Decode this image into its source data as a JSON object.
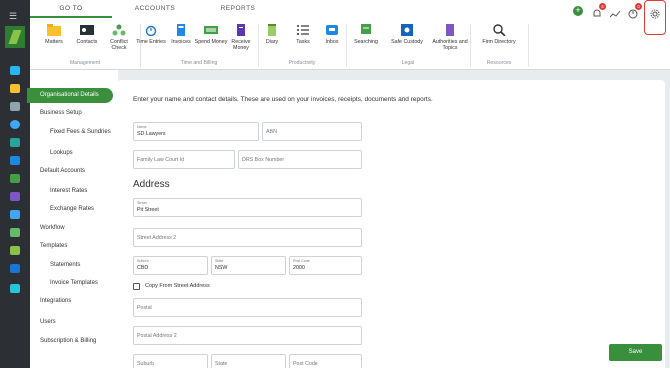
{
  "tabs": [
    "GO TO",
    "ACCOUNTS",
    "REPORTS"
  ],
  "badges": {
    "notifications": "4",
    "timer": "0"
  },
  "ribbon": {
    "items": [
      {
        "label": "Matters",
        "icon": "folder-icon"
      },
      {
        "label": "Contacts",
        "icon": "contact-card-icon"
      },
      {
        "label": "Conflict Check",
        "icon": "org-chart-icon"
      },
      {
        "label": "Time Entries",
        "icon": "stopwatch-icon"
      },
      {
        "label": "Invoices",
        "icon": "calculator-icon"
      },
      {
        "label": "Spend Money",
        "icon": "cash-out-icon"
      },
      {
        "label": "Receive Money",
        "icon": "receive-money-icon"
      },
      {
        "label": "Diary",
        "icon": "notepad-icon"
      },
      {
        "label": "Tasks",
        "icon": "task-list-icon"
      },
      {
        "label": "Inbox",
        "icon": "inbox-icon"
      },
      {
        "label": "Searching",
        "icon": "search-doc-icon"
      },
      {
        "label": "Safe Custody",
        "icon": "safe-icon"
      },
      {
        "label": "Authorities and Topics",
        "icon": "book-icon"
      },
      {
        "label": "Firm Directory",
        "icon": "magnifier-icon"
      }
    ],
    "groups": [
      "Management",
      "Time and Billing",
      "Productivity",
      "Legal",
      "Resources"
    ]
  },
  "sidebar": [
    "Organisational Details",
    "Business Setup",
    "Fixed Fees & Sundries",
    "Lookups",
    "Default Accounts",
    "Interest Rates",
    "Exchange Rates",
    "Workflow",
    "Templates",
    "Statements",
    "Invoice Templates",
    "Integrations",
    "Users",
    "Subscription & Billing"
  ],
  "form": {
    "intro": "Enter your name and contact details. These are used on your invoices, receipts, documents and reports.",
    "name": {
      "label": "Name",
      "value": "SD Lawyers"
    },
    "abn": "ABN",
    "family_law_court_id": "Family Law Court Id",
    "drs_box_number": "DRS Box Number",
    "address_heading": "Address",
    "street": {
      "label": "Street",
      "value": "Pit Street"
    },
    "street_address_2": "Street Address 2",
    "suburb": {
      "label": "Suburb",
      "value": "CBD"
    },
    "state": {
      "label": "State",
      "value": "NSW"
    },
    "post_code": {
      "label": "Post Code",
      "value": "2000"
    },
    "copy_checkbox": "Copy From Street Address",
    "postal": "Postal",
    "postal_address_2": "Postal Address 2",
    "postal_suburb": "Suburb",
    "postal_state": "State",
    "postal_post_code": "Post Code",
    "save": "Save"
  },
  "colors": {
    "accent": "#3a8f3d",
    "rail": "#2c3035",
    "badge": "#e53935"
  }
}
